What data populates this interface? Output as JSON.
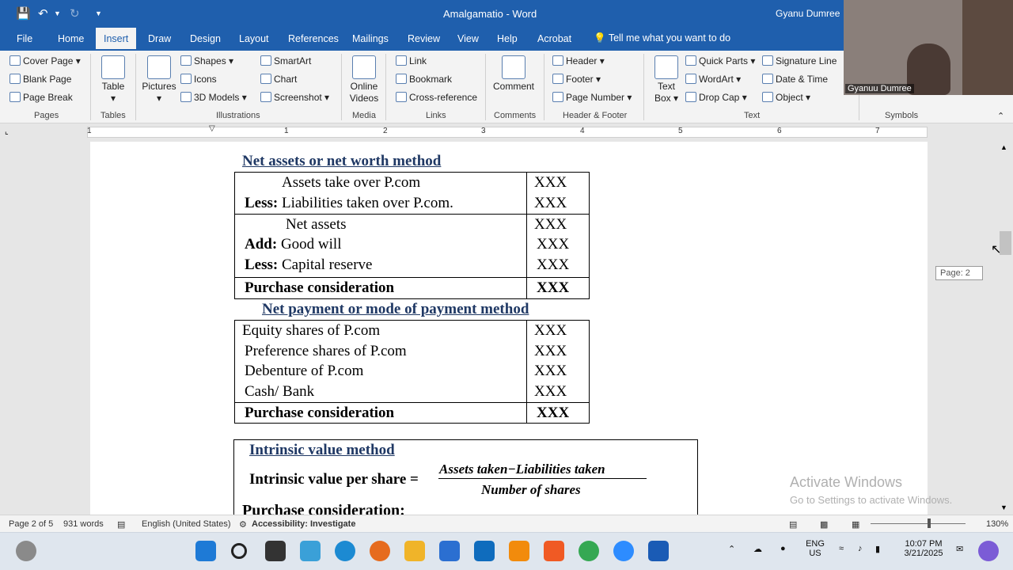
{
  "window": {
    "title": "Amalgamatio  -  Word",
    "user": "Gyanu Dumree"
  },
  "menu": {
    "tabs": [
      "File",
      "Home",
      "Insert",
      "Draw",
      "Design",
      "Layout",
      "References",
      "Mailings",
      "Review",
      "View",
      "Help",
      "Acrobat"
    ],
    "active": "Insert",
    "tell_me": "Tell me what you want to do"
  },
  "ribbon": {
    "pages": {
      "cover_page": "Cover Page",
      "blank_page": "Blank Page",
      "page_break": "Page Break",
      "group": "Pages"
    },
    "tables": {
      "table": "Table",
      "group": "Tables"
    },
    "illustrations": {
      "pictures": "Pictures",
      "shapes": "Shapes",
      "icons": "Icons",
      "models_3d": "3D Models",
      "smartart": "SmartArt",
      "chart": "Chart",
      "screenshot": "Screenshot",
      "group": "Illustrations"
    },
    "media": {
      "online_videos_1": "Online",
      "online_videos_2": "Videos",
      "group": "Media"
    },
    "links": {
      "link": "Link",
      "bookmark": "Bookmark",
      "cross_reference": "Cross-reference",
      "group": "Links"
    },
    "comments": {
      "comment": "Comment",
      "group": "Comments"
    },
    "header_footer": {
      "header": "Header",
      "footer": "Footer",
      "page_number": "Page Number",
      "group": "Header & Footer"
    },
    "text": {
      "text_box_1": "Text",
      "text_box_2": "Box",
      "quick_parts": "Quick Parts",
      "wordart": "WordArt",
      "drop_cap": "Drop Cap",
      "signature_line": "Signature Line",
      "date_time": "Date & Time",
      "object": "Object",
      "group": "Text"
    },
    "symbols": {
      "group": "Symbols"
    }
  },
  "ruler": {
    "numbers": [
      "1",
      "1",
      "2",
      "3",
      "4",
      "5",
      "6",
      "7"
    ]
  },
  "document": {
    "section1": {
      "heading": "Net assets or net worth method",
      "rows": [
        {
          "label_bold": "",
          "label": "Assets take over P.com",
          "value": "XXX"
        },
        {
          "label_bold": "Less:",
          "label": " Liabilities taken over P.com.",
          "value": "XXX"
        },
        {
          "label_bold": "",
          "label": "Net assets",
          "value": "XXX"
        },
        {
          "label_bold": "Add:",
          "label": " Good will",
          "value": "XXX"
        },
        {
          "label_bold": "Less:",
          "label": " Capital reserve",
          "value": "XXX"
        }
      ],
      "total_label": "Purchase consideration",
      "total_value": "XXX"
    },
    "section2": {
      "heading": "Net payment or mode of payment method",
      "rows": [
        {
          "label": "Equity shares of P.com",
          "value": "XXX"
        },
        {
          "label": "Preference shares of P.com",
          "value": "XXX"
        },
        {
          "label": "Debenture of P.com",
          "value": "XXX"
        },
        {
          "label": "Cash/ Bank",
          "value": "XXX"
        }
      ],
      "total_label": "Purchase consideration",
      "total_value": "XXX"
    },
    "section3": {
      "heading": "Intrinsic value method",
      "formula_label": "Intrinsic value per share =",
      "numerator": "Assets taken−Liabilities taken",
      "denominator": "Number of shares",
      "cut_text": "Purchase consideration:"
    }
  },
  "watermark": {
    "line1": "Activate Windows",
    "line2": "Go to Settings to activate Windows."
  },
  "page_tooltip": "Page: 2",
  "status": {
    "page": "Page 2 of 5",
    "words": "931 words",
    "language": "English (United States)",
    "accessibility": "Accessibility: Investigate",
    "zoom": "130%"
  },
  "taskbar": {
    "lang_1": "ENG",
    "lang_2": "US",
    "time": "10:07 PM",
    "date": "3/21/2025"
  },
  "webcam": {
    "name": "Gyanuu Dumree"
  }
}
